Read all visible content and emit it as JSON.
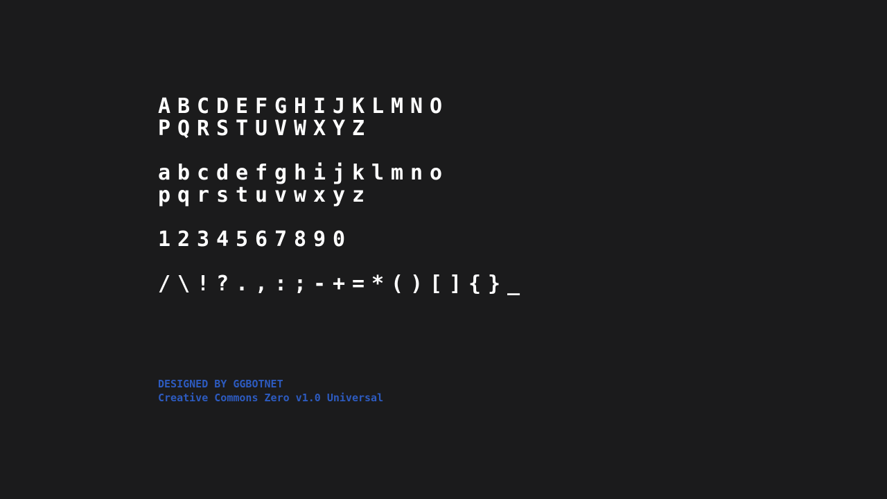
{
  "specimen": {
    "rows": [
      [
        "A",
        "B",
        "C",
        "D",
        "E",
        "F",
        "G",
        "H",
        "I",
        "J",
        "K",
        "L",
        "M",
        "N",
        "O"
      ],
      [
        "P",
        "Q",
        "R",
        "S",
        "T",
        "U",
        "V",
        "W",
        "X",
        "Y",
        "Z"
      ],
      [
        "a",
        "b",
        "c",
        "d",
        "e",
        "f",
        "g",
        "h",
        "i",
        "j",
        "k",
        "l",
        "m",
        "n",
        "o"
      ],
      [
        "p",
        "q",
        "r",
        "s",
        "t",
        "u",
        "v",
        "w",
        "x",
        "y",
        "z"
      ],
      [
        "1",
        "2",
        "3",
        "4",
        "5",
        "6",
        "7",
        "8",
        "9",
        "0"
      ],
      [
        "/",
        "\\",
        "!",
        "?",
        ".",
        ",",
        ":",
        ";",
        "-",
        "+",
        "=",
        "*",
        "(",
        ")",
        "[",
        "]",
        "{",
        "}",
        "_"
      ]
    ],
    "gap_before_rows": [
      2,
      4,
      5
    ],
    "glyph_color": "#ffffff"
  },
  "credits": {
    "designer": "DESIGNED BY GGBOTNET",
    "license": "Creative Commons Zero v1.0 Universal",
    "color": "#2d5bc0"
  },
  "background": "#1b1b1c"
}
